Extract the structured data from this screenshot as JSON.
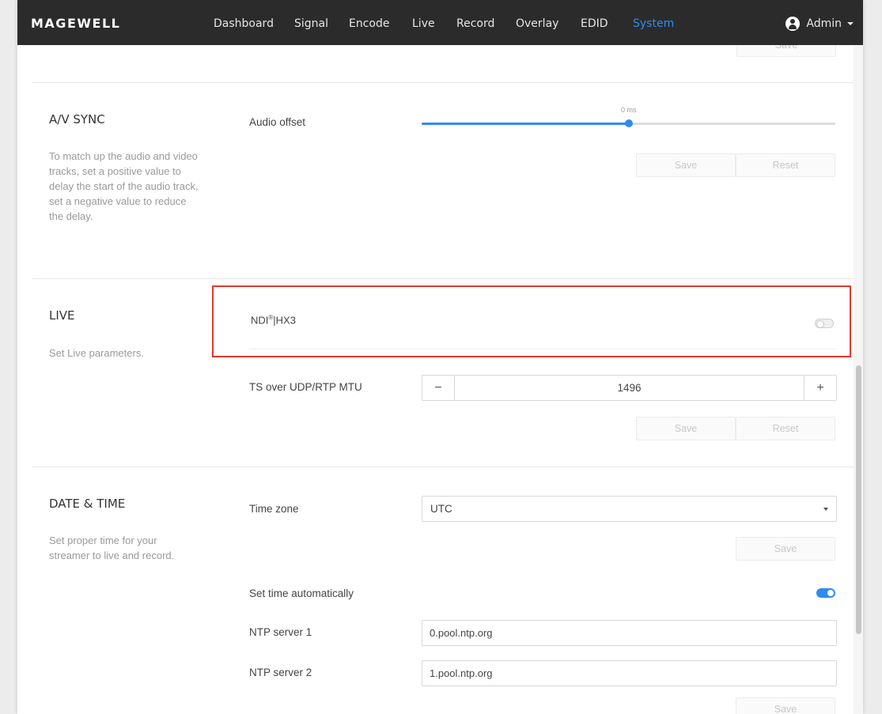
{
  "brand": {
    "logo_text": "MAGEWELL",
    "accent_color": "#2f8bf0",
    "highlight_color": "#e03a2e"
  },
  "nav": {
    "items": [
      {
        "label": "Dashboard"
      },
      {
        "label": "Signal"
      },
      {
        "label": "Encode"
      },
      {
        "label": "Live"
      },
      {
        "label": "Record"
      },
      {
        "label": "Overlay"
      },
      {
        "label": "EDID"
      },
      {
        "label": "System",
        "active": true
      }
    ],
    "user": {
      "icon": "user-icon",
      "name": "Admin"
    }
  },
  "top_partial": {
    "save_label": "Save"
  },
  "av_sync": {
    "title": "A/V SYNC",
    "description": "To match up the audio and video tracks, set a positive value to delay the start of the audio track, set a negative value to reduce the delay.",
    "audio_offset_label": "Audio offset",
    "slider_value_text": "0 ms",
    "slider_fraction": 0.5,
    "save_label": "Save",
    "reset_label": "Reset"
  },
  "live": {
    "title": "LIVE",
    "description": "Set Live parameters.",
    "ndi_label": "NDI",
    "ndi_sup": "®",
    "ndi_suffix": "|HX3",
    "ndi_enabled": false,
    "mtu_label": "TS over UDP/RTP MTU",
    "mtu_minus": "−",
    "mtu_value": "1496",
    "mtu_plus": "+",
    "save_label": "Save",
    "reset_label": "Reset"
  },
  "datetime": {
    "title": "DATE & TIME",
    "description": "Set proper time for your streamer to live and record.",
    "timezone_label": "Time zone",
    "timezone_value": "UTC",
    "save_label": "Save",
    "auto_time_label": "Set time automatically",
    "auto_time_enabled": true,
    "ntp1_label": "NTP server 1",
    "ntp1_value": "0.pool.ntp.org",
    "ntp2_label": "NTP server 2",
    "ntp2_value": "1.pool.ntp.org",
    "save2_label": "Save"
  }
}
